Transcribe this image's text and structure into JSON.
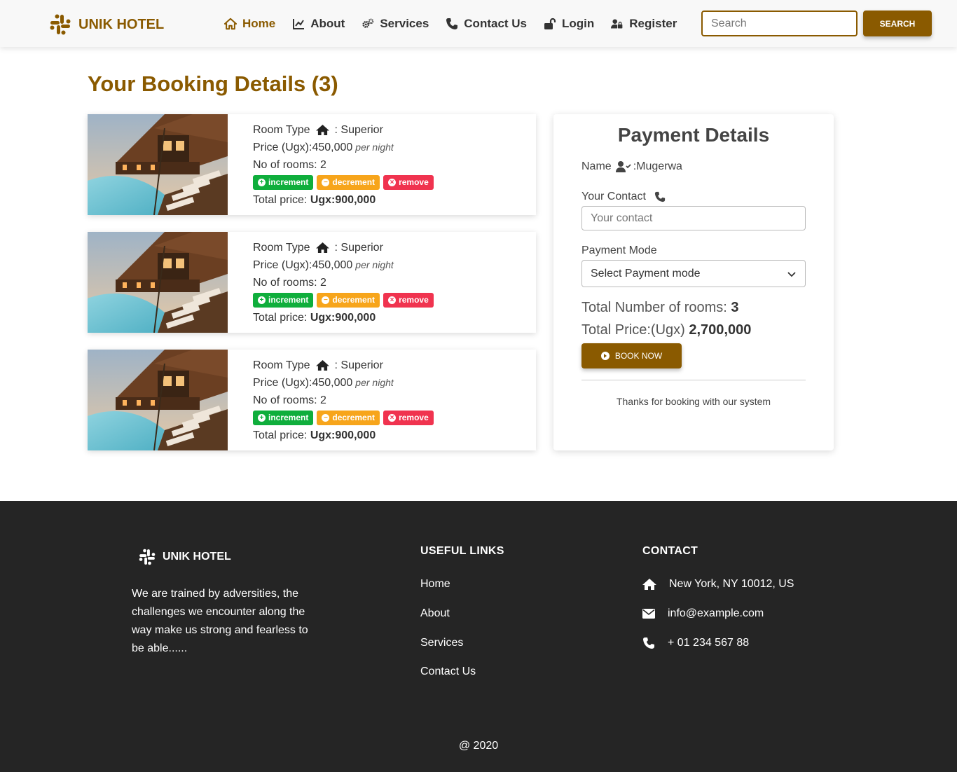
{
  "brand": {
    "name": "UNIK HOTEL",
    "color": "#8a5a00"
  },
  "nav": {
    "items": [
      {
        "label": "Home",
        "icon": "home-icon",
        "active": true
      },
      {
        "label": "About",
        "icon": "chart-line-icon"
      },
      {
        "label": "Services",
        "icon": "gears-icon"
      },
      {
        "label": "Contact Us",
        "icon": "phone-icon"
      },
      {
        "label": "Login",
        "icon": "unlock-icon"
      },
      {
        "label": "Register",
        "icon": "user-lock-icon"
      }
    ],
    "search_placeholder": "Search",
    "search_button": "SEARCH"
  },
  "page_title": "Your Booking Details (3)",
  "bookings": [
    {
      "room_type_label": "Room Type",
      "room_type": ": Superior",
      "price_label": "Price (Ugx):",
      "price": "450,000",
      "per_night": "per night",
      "rooms_label": "No of rooms:",
      "rooms": "2",
      "increment": "increment",
      "decrement": "decrement",
      "remove": "remove",
      "total_label": "Total price:",
      "total": "Ugx:900,000"
    },
    {
      "room_type_label": "Room Type",
      "room_type": ": Superior",
      "price_label": "Price (Ugx):",
      "price": "450,000",
      "per_night": "per night",
      "rooms_label": "No of rooms:",
      "rooms": "2",
      "increment": "increment",
      "decrement": "decrement",
      "remove": "remove",
      "total_label": "Total price:",
      "total": "Ugx:900,000"
    },
    {
      "room_type_label": "Room Type",
      "room_type": ": Superior",
      "price_label": "Price (Ugx):",
      "price": "450,000",
      "per_night": "per night",
      "rooms_label": "No of rooms:",
      "rooms": "2",
      "increment": "increment",
      "decrement": "decrement",
      "remove": "remove",
      "total_label": "Total price:",
      "total": "Ugx:900,000"
    }
  ],
  "payment": {
    "title": "Payment Details",
    "name_label": "Name",
    "name_value": ":Mugerwa",
    "contact_label": "Your Contact",
    "contact_placeholder": "Your contact",
    "mode_label": "Payment Mode",
    "mode_selected": "Select Payment mode",
    "total_rooms_label": "Total Number of rooms:",
    "total_rooms": "3",
    "total_price_label": "Total Price:(Ugx)",
    "total_price": "2,700,000",
    "book_button": "BOOK NOW",
    "thanks": "Thanks for booking with our system"
  },
  "footer": {
    "brand": "UNIK HOTEL",
    "description": "We are trained by adversities, the challenges we encounter along the way make us strong and fearless to be able......",
    "links_heading": "USEFUL LINKS",
    "links": [
      "Home",
      "About",
      "Services",
      "Contact Us"
    ],
    "contact_heading": "CONTACT",
    "address": "New York, NY 10012, US",
    "email": "info@example.com",
    "phone": "+ 01 234 567 88",
    "copyright": "@ 2020"
  }
}
